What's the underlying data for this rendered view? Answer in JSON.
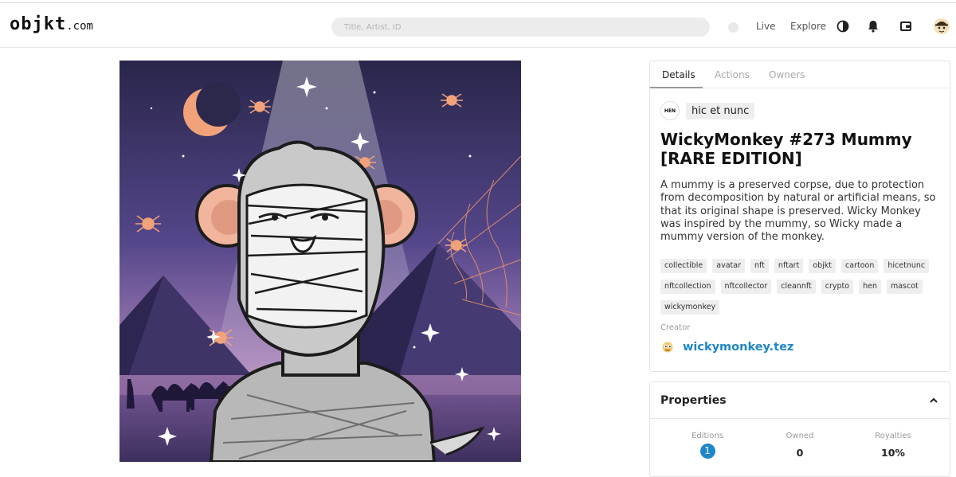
{
  "header": {
    "logo_main": "objkt",
    "logo_suffix": ".com",
    "search_placeholder": "Title, Artist, ID",
    "nav": {
      "live": "Live",
      "explore": "Explore"
    },
    "icons": [
      "theme-toggle-icon",
      "bell-icon",
      "wallet-icon",
      "avatar"
    ]
  },
  "artwork": {
    "icons": [
      "moon-icon",
      "spider-icon",
      "cobweb-icon",
      "pyramid-icon",
      "camel-icon",
      "mummy-monkey"
    ]
  },
  "details": {
    "tabs": [
      {
        "label": "Details",
        "active": true
      },
      {
        "label": "Actions",
        "active": false
      },
      {
        "label": "Owners",
        "active": false
      }
    ],
    "platform": {
      "logo_text": "HEN",
      "name": "hic et nunc"
    },
    "title": "WickyMonkey #273 Mummy [RARE EDITION]",
    "description": "A mummy is a preserved corpse, due to protection from decomposition by natural or artificial means, so that its original shape is preserved. Wicky Monkey was inspired by the mummy, so Wicky made a mummy version of the monkey.",
    "tags": [
      "collectible",
      "avatar",
      "nft",
      "nftart",
      "objkt",
      "cartoon",
      "hicetnunc",
      "nftcollection",
      "nftcollector",
      "cleannft",
      "crypto",
      "hen",
      "mascot",
      "wickymonkey"
    ],
    "creator_label": "Creator",
    "creator_name": "wickymonkey.tez"
  },
  "properties": {
    "title": "Properties",
    "stats": [
      {
        "label": "Editions",
        "value": "1"
      },
      {
        "label": "Owned",
        "value": "0"
      },
      {
        "label": "Royalties",
        "value": "10%"
      }
    ]
  },
  "colors": {
    "link_blue": "#1f86c8",
    "sky_top": "#2b2748",
    "sky_bottom": "#b183b2",
    "accent_orange": "#f2a27a"
  }
}
